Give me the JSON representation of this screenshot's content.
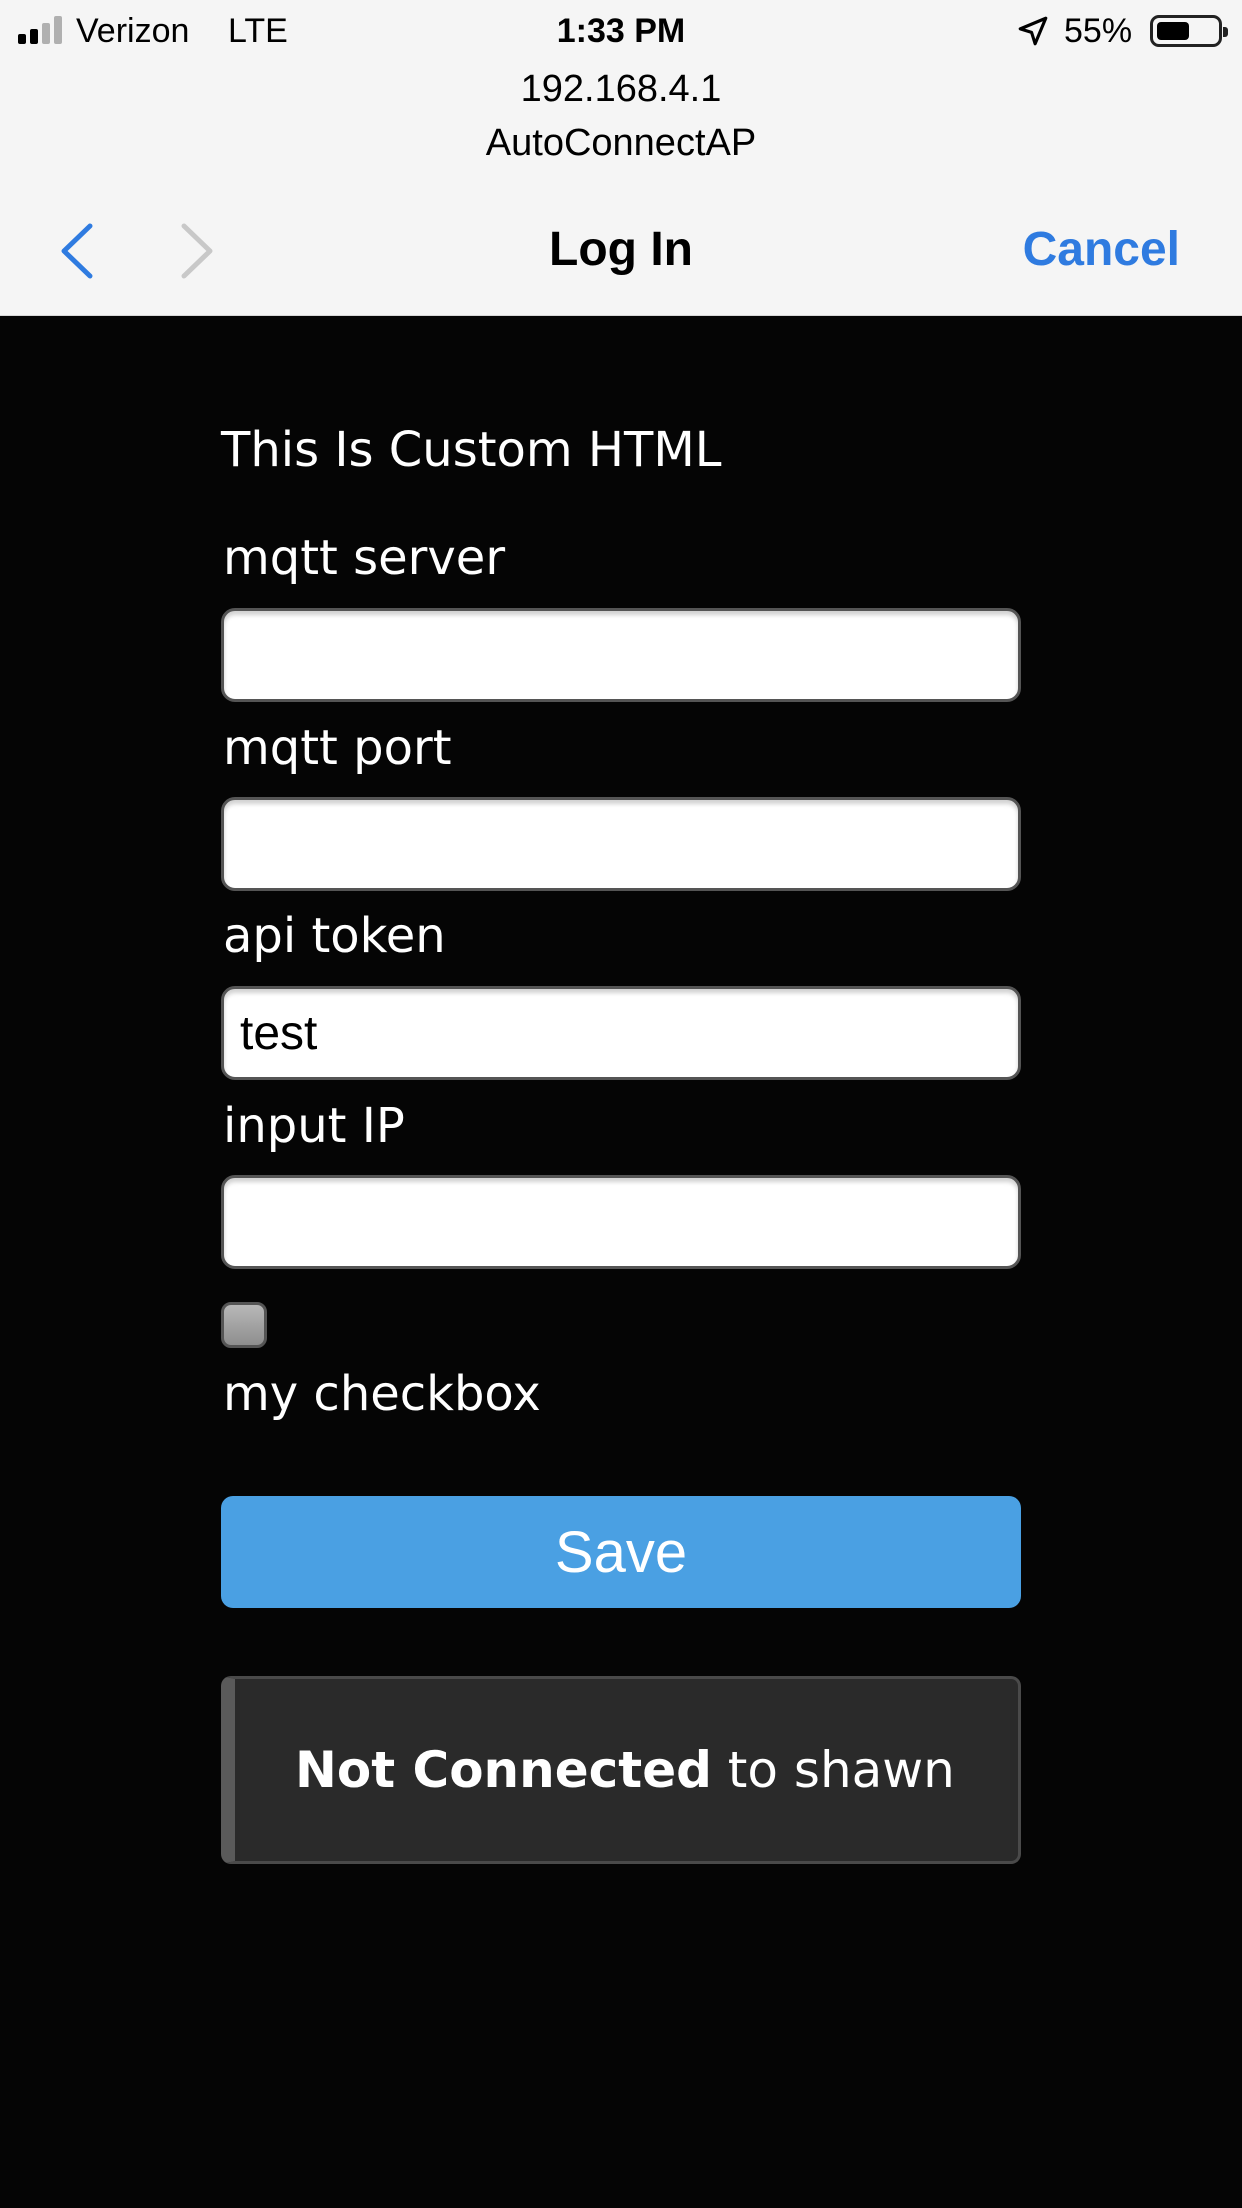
{
  "status_bar": {
    "carrier": "Verizon",
    "network": "LTE",
    "time": "1:33 PM",
    "battery_percent": "55%",
    "battery_level": 0.55,
    "location_icon": "location-arrow-icon"
  },
  "browser": {
    "url": "192.168.4.1",
    "site_name": "AutoConnectAP",
    "title": "Log In",
    "cancel_label": "Cancel",
    "back_icon": "chevron-left-icon",
    "forward_icon": "chevron-right-icon",
    "accent_color": "#2f7be0"
  },
  "form": {
    "heading": "This Is Custom HTML",
    "fields": [
      {
        "label": "mqtt server",
        "value": ""
      },
      {
        "label": "mqtt port",
        "value": ""
      },
      {
        "label": "api token",
        "value": "test"
      },
      {
        "label": "input IP",
        "value": ""
      }
    ],
    "checkbox": {
      "label": "my checkbox",
      "checked": false
    },
    "save_label": "Save",
    "save_color": "#4aa0e3"
  },
  "status_notice": {
    "bold_text": "Not Connected",
    "rest_text": " to shawn"
  }
}
